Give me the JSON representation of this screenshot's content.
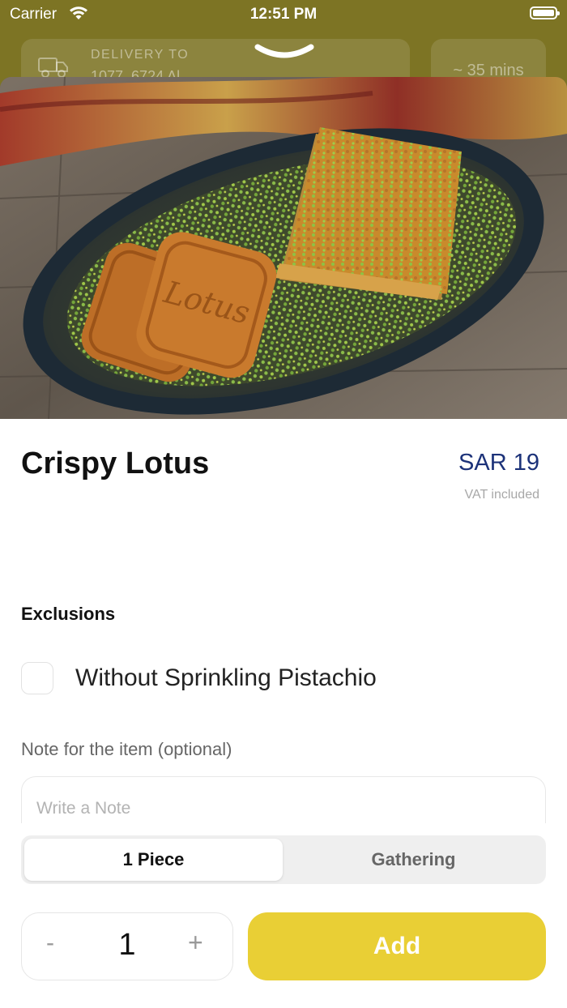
{
  "status_bar": {
    "carrier": "Carrier",
    "time": "12:51 PM"
  },
  "header": {
    "delivery_label": "DELIVERY TO",
    "delivery_address": "1077, 6724 Al ...",
    "eta": "~ 35 mins"
  },
  "product": {
    "name": "Crispy Lotus",
    "price": "SAR 19",
    "vat_note": "VAT included"
  },
  "exclusions": {
    "title": "Exclusions",
    "options": [
      {
        "label": "Without Sprinkling Pistachio",
        "checked": false
      }
    ]
  },
  "note": {
    "title": "Note for the item (optional)",
    "placeholder": "Write a Note",
    "value": ""
  },
  "size_options": {
    "options": [
      "1 Piece",
      "Gathering"
    ],
    "selected": "1 Piece"
  },
  "cart": {
    "minus": "-",
    "quantity": "1",
    "plus": "+",
    "add_label": "Add"
  },
  "colors": {
    "header_bg": "#7d7424",
    "price": "#1c3279",
    "add_button": "#e9cf35"
  },
  "icons": {
    "wifi": "wifi-icon",
    "battery": "battery-icon",
    "truck": "delivery-truck-icon",
    "chevron": "chevron-down-icon"
  }
}
